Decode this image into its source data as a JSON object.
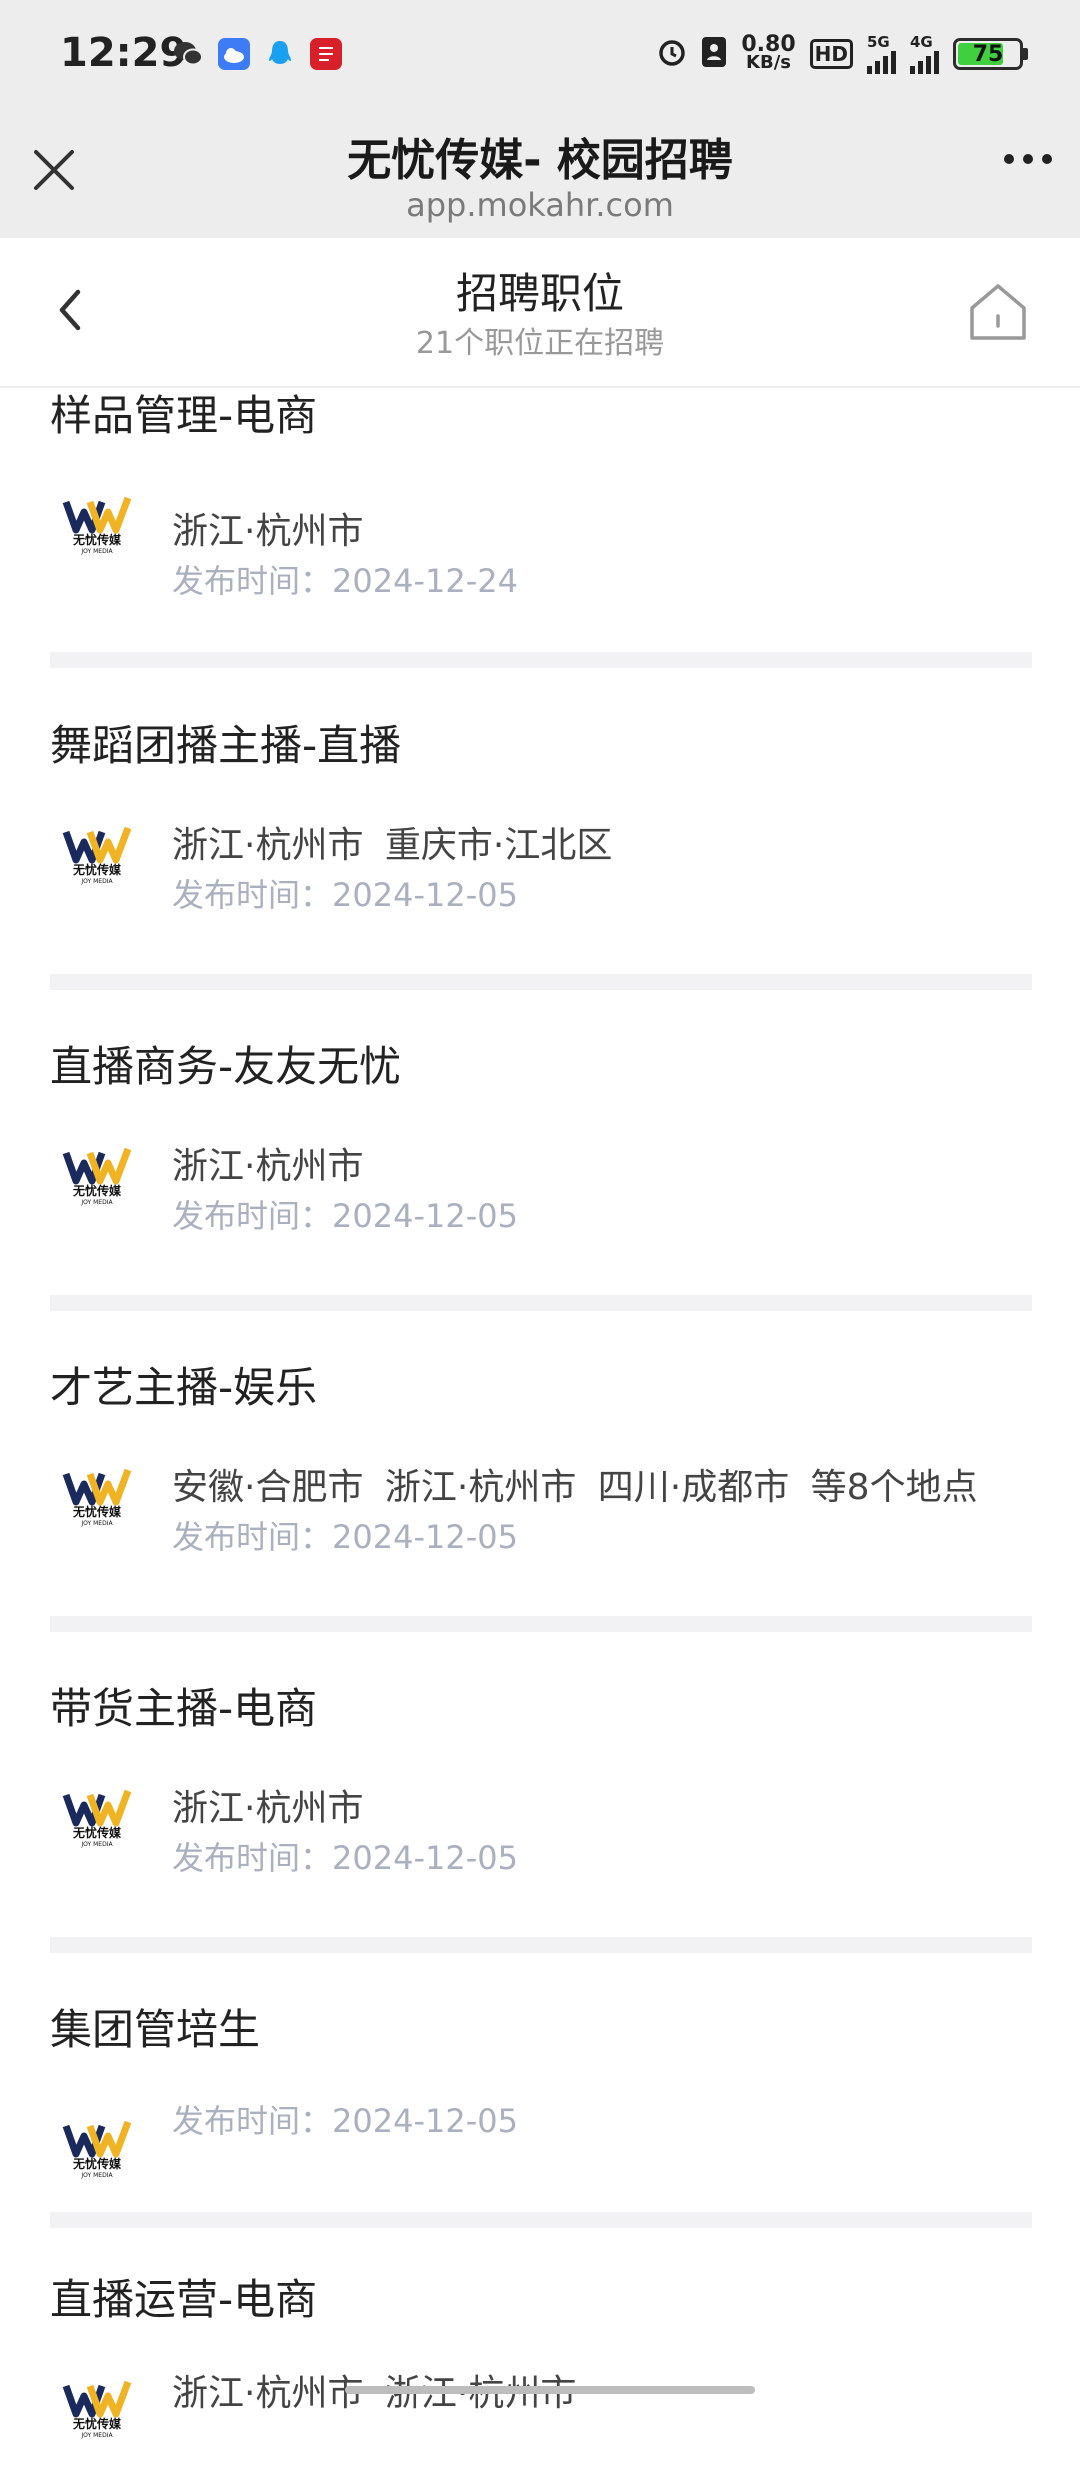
{
  "status_bar": {
    "time": "12:29",
    "net_speed_value": "0.80",
    "net_speed_unit": "KB/s",
    "hd_label": "HD",
    "sim1_label": "5G",
    "sim2_label": "4G",
    "battery_level": 75,
    "battery_text": "75",
    "battery_color": "#3fcf3f"
  },
  "browser": {
    "title": "无忧传媒- 校园招聘",
    "url": "app.mokahr.com"
  },
  "page_header": {
    "title": "招聘职位",
    "subtitle": "21个职位正在招聘"
  },
  "jobs": [
    {
      "title": "样品管理-电商",
      "location": "浙江·杭州市",
      "date": "发布时间：2024-12-24"
    },
    {
      "title": "舞蹈团播主播-直播",
      "location": "浙江·杭州市  重庆市·江北区",
      "date": "发布时间：2024-12-05"
    },
    {
      "title": "直播商务-友友无忧",
      "location": "浙江·杭州市",
      "date": "发布时间：2024-12-05"
    },
    {
      "title": "才艺主播-娱乐",
      "location": "安徽·合肥市  浙江·杭州市  四川·成都市  等8个地点",
      "date": "发布时间：2024-12-05"
    },
    {
      "title": "带货主播-电商",
      "location": "浙江·杭州市",
      "date": "发布时间：2024-12-05"
    },
    {
      "title": "集团管培生",
      "location": "",
      "date": "发布时间：2024-12-05"
    },
    {
      "title": "直播运营-电商",
      "location": "浙江·杭州市  浙江·杭州市",
      "date": ""
    }
  ],
  "logo": {
    "brand_line": "无忧传媒",
    "sub_line": "JOY MEDIA"
  }
}
